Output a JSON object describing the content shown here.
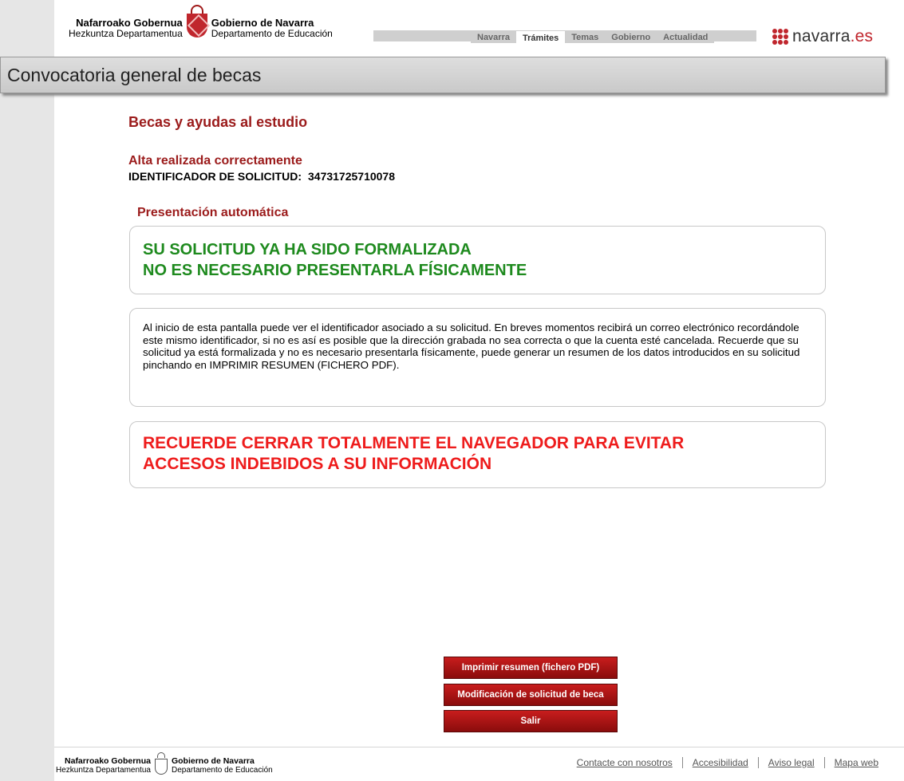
{
  "header": {
    "logo": {
      "left_line1": "Nafarroako Gobernua",
      "left_line2": "Hezkuntza Departamentua",
      "right_line1": "Gobierno de Navarra",
      "right_line2": "Departamento de Educación"
    },
    "nav_tabs": [
      {
        "label": "Navarra",
        "active": false
      },
      {
        "label": "Trámites",
        "active": true
      },
      {
        "label": "Temas",
        "active": false
      },
      {
        "label": "Gobierno",
        "active": false
      },
      {
        "label": "Actualidad",
        "active": false
      }
    ],
    "brand": {
      "name": "navarra",
      "suffix": ".es",
      "accent": "#c0262d"
    }
  },
  "title_bar": {
    "title": "Convocatoria general de becas"
  },
  "main": {
    "section_title": "Becas y ayudas al estudio",
    "status": "Alta realizada correctamente",
    "identifier_label": "IDENTIFICADOR DE SOLICITUD:",
    "identifier_value": "34731725710078",
    "presentation_title": "Presentación automática",
    "formalized_line1": "SU SOLICITUD YA HA SIDO FORMALIZADA",
    "formalized_line2": "NO ES NECESARIO PRESENTARLA FÍSICAMENTE",
    "info_text": "Al inicio de esta pantalla puede ver el identificador asociado a su solicitud. En breves momentos recibirá un correo electrónico recordándole este mismo identificador, si no es así es posible que la dirección grabada no sea correcta o que la cuenta esté cancelada. Recuerde que su solicitud ya está formalizada y no es necesario presentarla físicamente, puede generar un resumen de los datos introducidos en su solicitud pinchando en IMPRIMIR RESUMEN (FICHERO PDF).",
    "warning_line1": "RECUERDE CERRAR TOTALMENTE EL NAVEGADOR PARA EVITAR",
    "warning_line2": "ACCESOS INDEBIDOS A SU INFORMACIÓN"
  },
  "buttons": {
    "print_summary": "Imprimir resumen (fichero PDF)",
    "modify_request": "Modificación de solicitud de beca",
    "exit": "Salir"
  },
  "footer": {
    "logo": {
      "left_line1": "Nafarroako Gobernua",
      "left_line2": "Hezkuntza Departamentua",
      "right_line1": "Gobierno de Navarra",
      "right_line2": "Departamento de Educación"
    },
    "links": [
      "Contacte con nosotros",
      "Accesibilidad",
      "Aviso legal",
      "Mapa web"
    ]
  },
  "colors": {
    "title_red": "#9b1b1b",
    "success_green": "#1e8a1e",
    "warning_red": "#ee1c1c",
    "button_red": "#a81414"
  }
}
